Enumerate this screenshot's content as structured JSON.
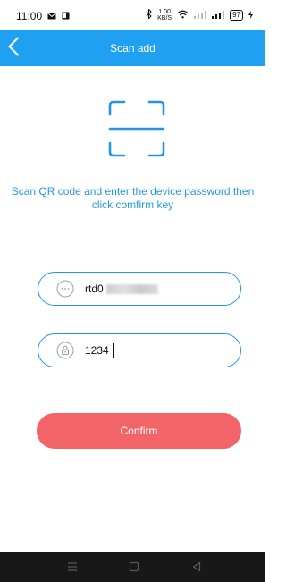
{
  "status_bar": {
    "time": "11:00",
    "speed_value": "1.00",
    "speed_unit": "KB/S",
    "battery": "97"
  },
  "header": {
    "title": "Scan add"
  },
  "instruction": {
    "line1": "Scan QR code and enter the device password then",
    "line2": "click comfirm key"
  },
  "form": {
    "device_id_value": "rtd0",
    "password_value": "1234"
  },
  "confirm_label": "Confirm",
  "colors": {
    "header": "#20a0f0",
    "accent": "#2196e8",
    "confirm": "#f26468",
    "nav_bar": "#181818"
  }
}
